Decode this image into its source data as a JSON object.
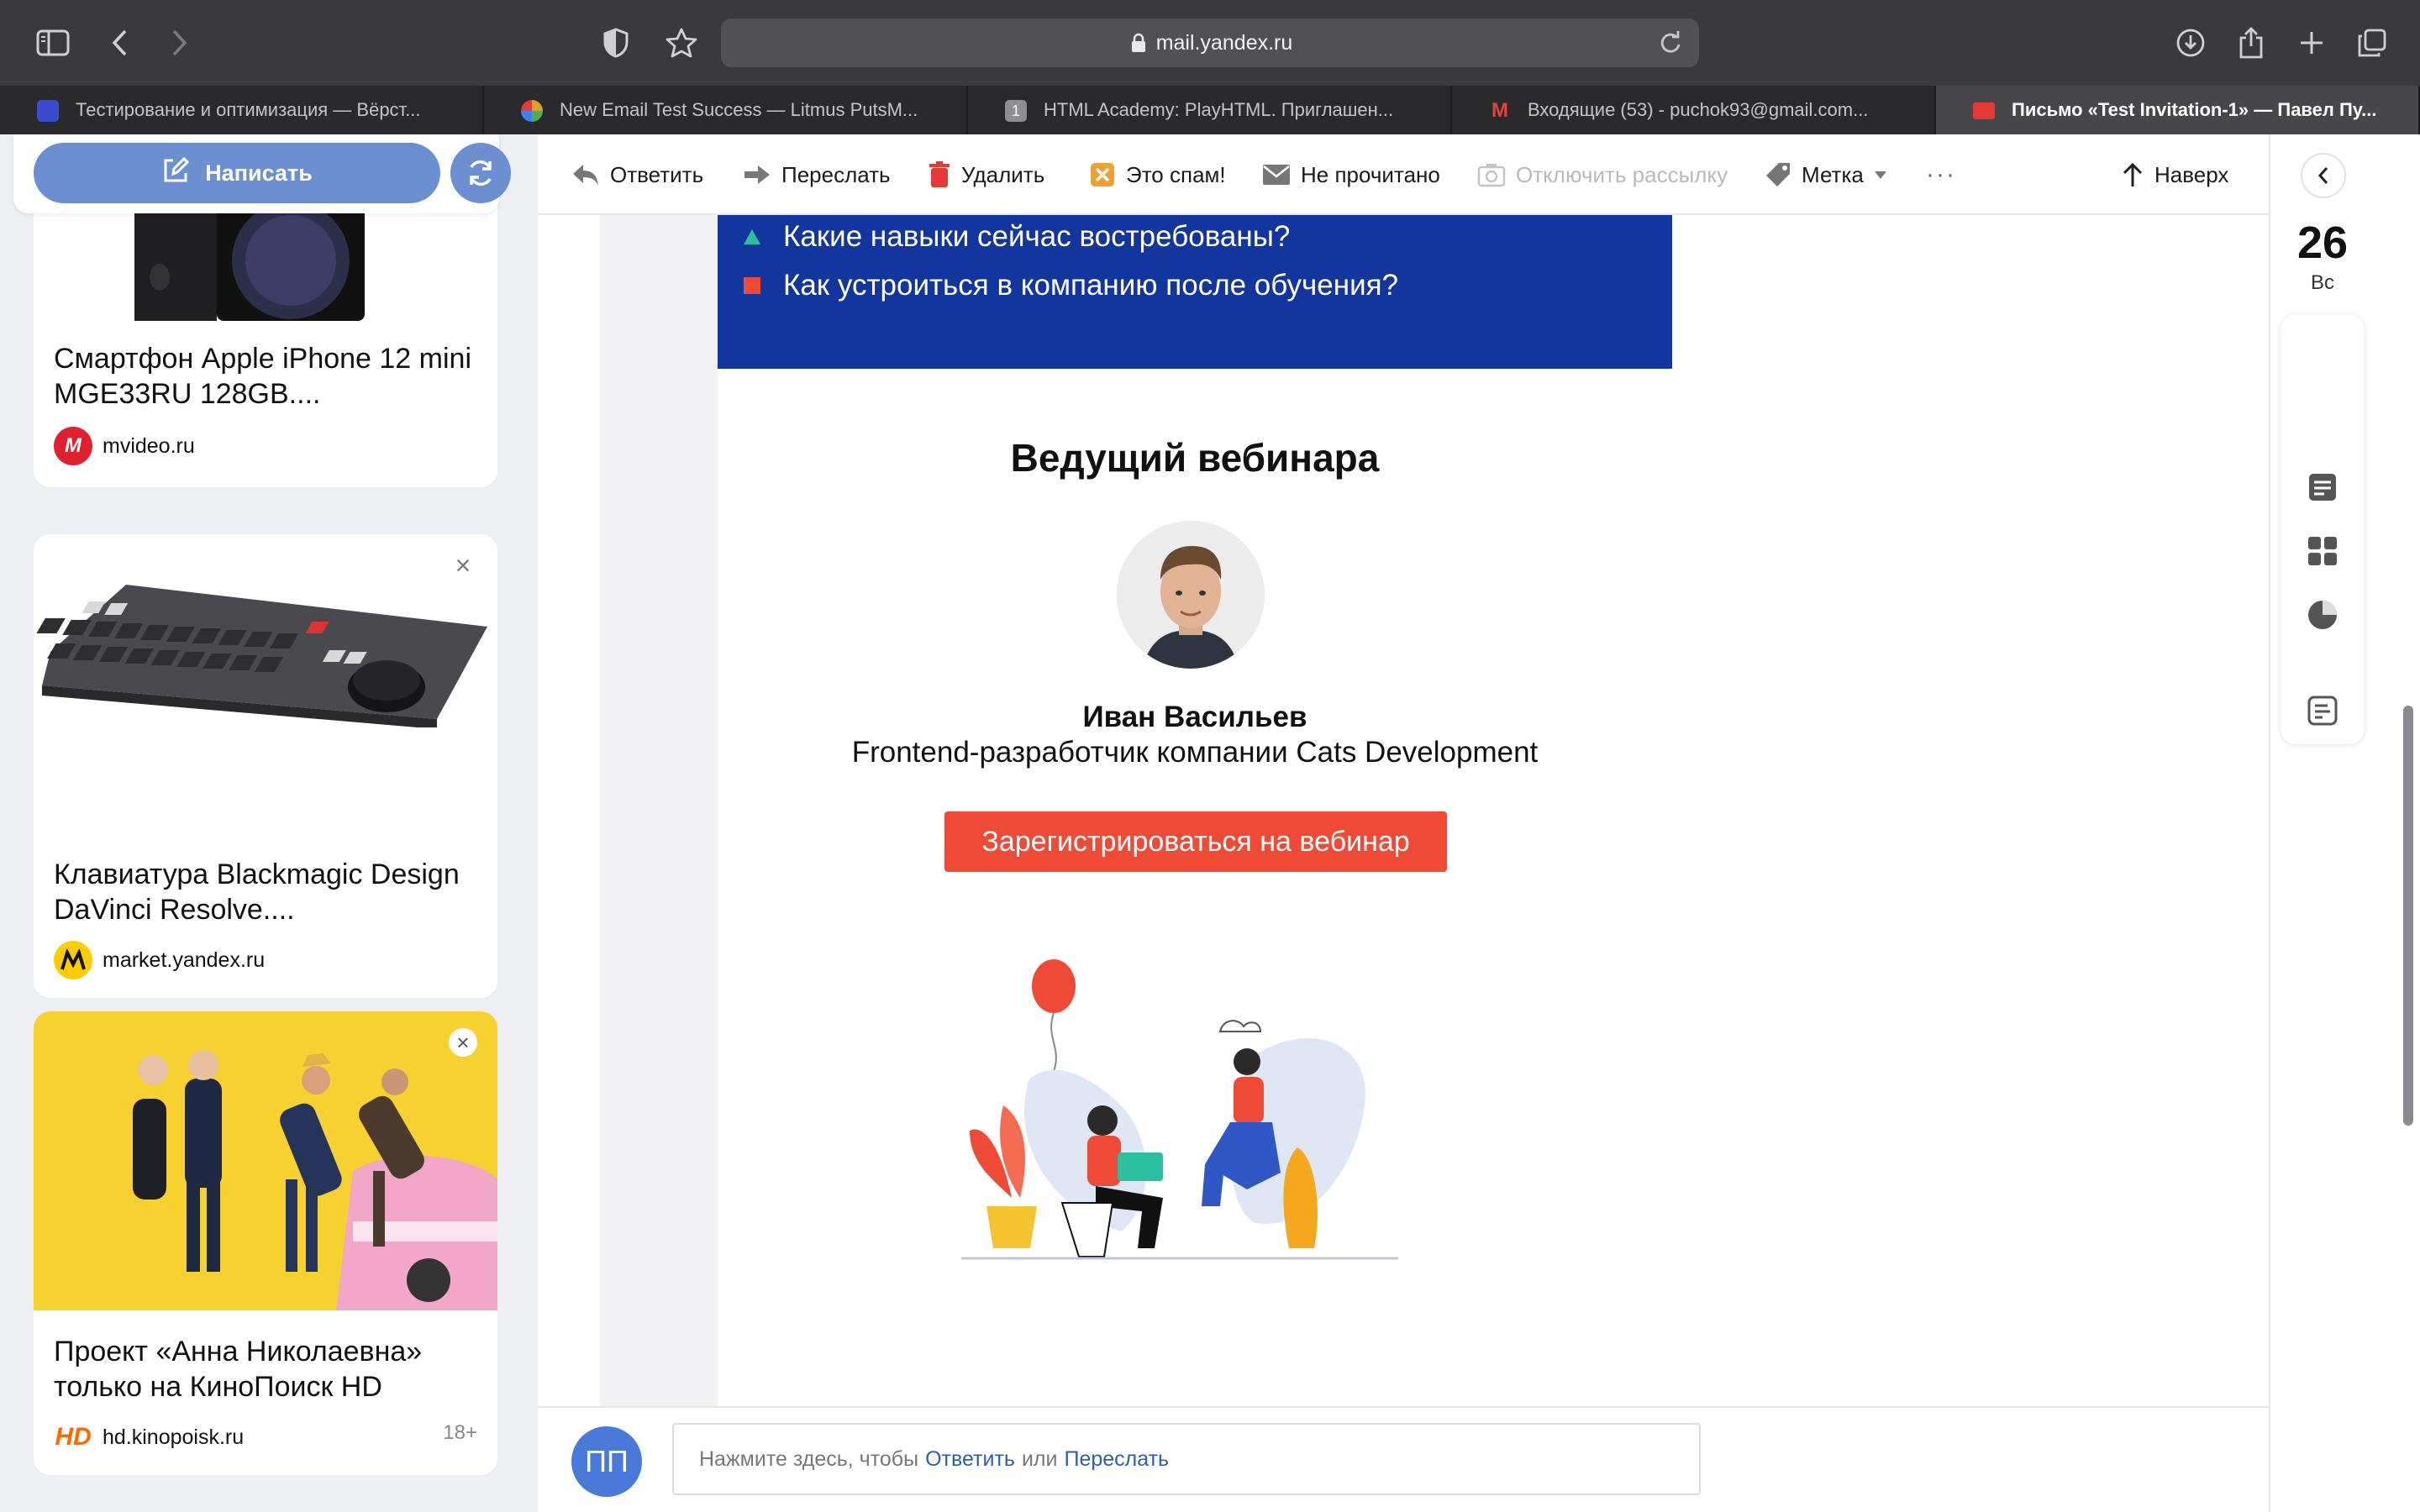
{
  "browser": {
    "url": "mail.yandex.ru",
    "tabs": [
      {
        "title": "Тестирование и оптимизация — Вёрст...",
        "favicon_color": "#3b4bd1"
      },
      {
        "title": "New Email Test Success — Litmus PutsM...",
        "favicon_color": "#e0a020"
      },
      {
        "title": "HTML Academy: PlayHTML. Приглашен...",
        "favicon_color": "#8e8e93",
        "favicon_text": "1"
      },
      {
        "title": "Входящие (53) - puchok93@gmail.com...",
        "favicon_color": "#ea4335",
        "favicon_text": "M"
      },
      {
        "title": "Письмо «Test Invitation-1» — Павел Пу...",
        "favicon_color": "#e53935",
        "active": true
      }
    ]
  },
  "sidebar": {
    "compose_label": "Написать",
    "ads": [
      {
        "title": "Смартфон Apple iPhone 12 mini MGE33RU 128GB....",
        "source": "mvideo.ru",
        "logo_text": "M",
        "logo_color": "#e0202f"
      },
      {
        "title": "Клавиатура Blackmagic Design DaVinci Resolve....",
        "source": "market.yandex.ru",
        "logo_color": "#ffcc00"
      },
      {
        "title": "Проект «Анна Николаевна» только на КиноПоиск HD",
        "source": "hd.kinopoisk.ru",
        "logo_text": "HD",
        "logo_color": "#ff6a00",
        "age": "18+"
      }
    ]
  },
  "toolbar": {
    "reply": "Ответить",
    "forward": "Переслать",
    "delete": "Удалить",
    "spam": "Это спам!",
    "unread": "Не прочитано",
    "unsubscribe": "Отключить рассылку",
    "label": "Метка",
    "more": "···",
    "top": "Наверх"
  },
  "email": {
    "questions": [
      {
        "text": "Какие навыки сейчас востребованы?",
        "marker": "triangle",
        "marker_color": "#2bbfa0"
      },
      {
        "text": "Как устроиться в компанию после обучения?",
        "marker": "square",
        "marker_color": "#ee4a36"
      }
    ],
    "host_heading": "Ведущий вебинара",
    "host_name": "Иван Васильев",
    "host_role": "Frontend-разработчик компании Cats Development",
    "register_button": "Зарегистрироваться на вебинар",
    "colors": {
      "header_bg": "#12359e",
      "button_bg": "#ee4a36"
    }
  },
  "reply_bar": {
    "avatar_initials": "ПП",
    "prefix": "Нажмите здесь, чтобы",
    "reply_link": "Ответить",
    "or": "или",
    "forward_link": "Переслать"
  },
  "right_panel": {
    "date": "26",
    "weekday": "Вс"
  }
}
